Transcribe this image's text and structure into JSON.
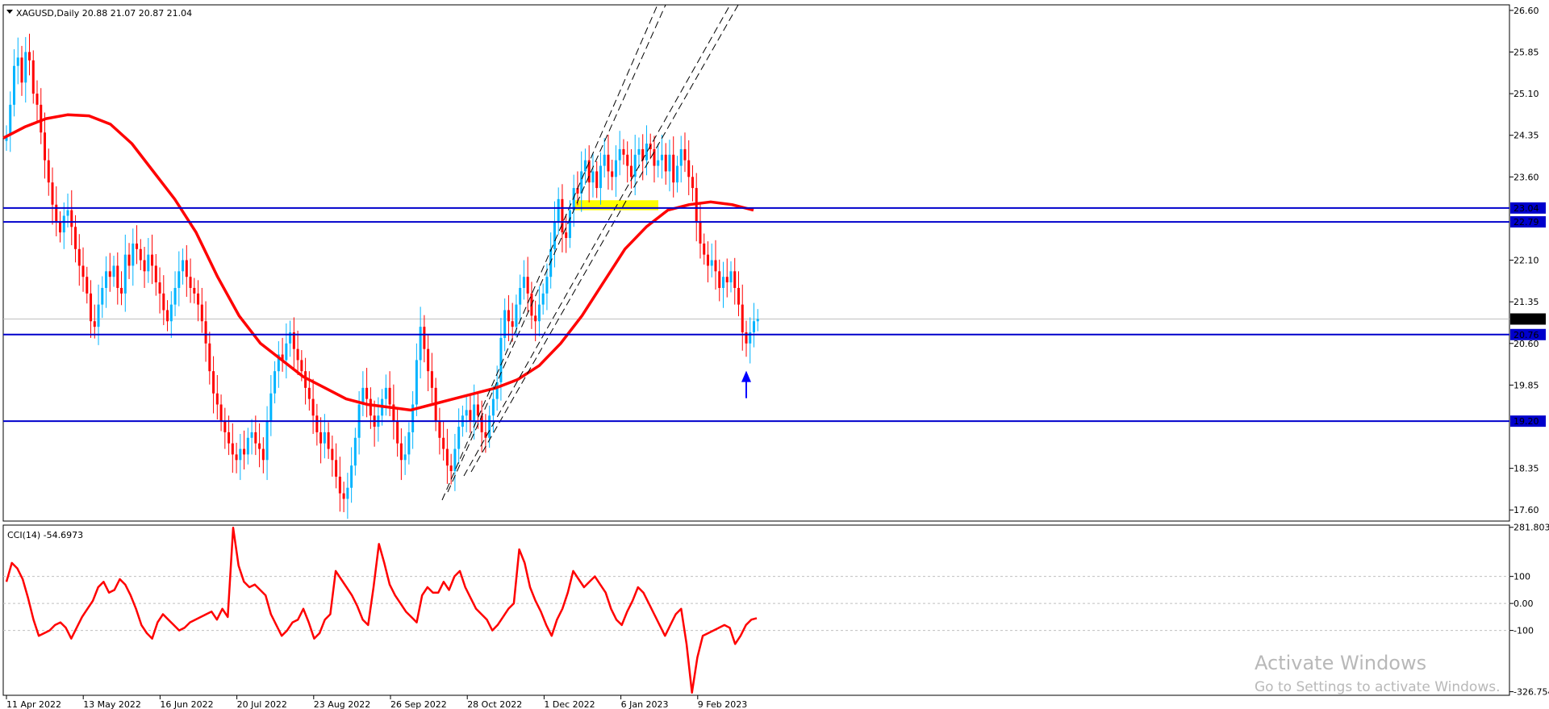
{
  "chart_data": [
    {
      "type": "candlestick",
      "symbol_header": "XAGUSD,Daily  20.88 21.07 20.87 21.04",
      "ohlc_last": {
        "open": 20.88,
        "high": 21.07,
        "low": 20.87,
        "close": 21.04
      },
      "ylim": [
        17.4,
        26.7
      ],
      "y_ticks": [
        "26.60",
        "25.85",
        "25.10",
        "24.35",
        "23.60",
        "22.10",
        "21.35",
        "20.60",
        "19.85",
        "18.35",
        "17.60"
      ],
      "x_ticks": [
        "11 Apr 2022",
        "13 May 2022",
        "16 Jun 2022",
        "20 Jul 2022",
        "23 Aug 2022",
        "26 Sep 2022",
        "28 Oct 2022",
        "1 Dec 2022",
        "6 Jan 2023",
        "9 Feb 2023"
      ],
      "current_price": {
        "value": 21.04,
        "label": "21.04"
      },
      "horizontal_levels": [
        {
          "value": 23.04,
          "label": "23.04"
        },
        {
          "value": 22.79,
          "label": "22.79"
        },
        {
          "value": 20.76,
          "label": "20.76"
        },
        {
          "value": 19.2,
          "label": "19.20"
        }
      ],
      "closes": [
        24.35,
        24.9,
        25.6,
        25.75,
        25.3,
        25.85,
        25.7,
        25.1,
        24.9,
        24.4,
        23.9,
        23.5,
        23.1,
        22.8,
        22.6,
        22.9,
        23.0,
        22.7,
        22.3,
        22.0,
        21.8,
        21.5,
        21.0,
        20.9,
        21.3,
        21.6,
        21.9,
        21.8,
        22.0,
        21.6,
        21.5,
        22.2,
        22.0,
        22.4,
        22.3,
        22.1,
        21.9,
        22.2,
        22.0,
        21.7,
        21.5,
        21.2,
        21.0,
        21.3,
        21.6,
        21.9,
        22.1,
        21.8,
        21.6,
        21.5,
        21.3,
        21.0,
        20.6,
        20.1,
        19.7,
        19.5,
        19.2,
        19.0,
        18.8,
        18.6,
        18.5,
        18.7,
        18.6,
        18.9,
        19.0,
        18.8,
        18.7,
        18.5,
        19.2,
        19.7,
        20.1,
        20.4,
        20.3,
        20.6,
        20.8,
        20.5,
        20.3,
        20.1,
        19.8,
        19.6,
        19.3,
        19.0,
        18.8,
        19.0,
        18.7,
        18.5,
        18.2,
        17.9,
        17.8,
        18.0,
        18.4,
        18.9,
        19.5,
        19.8,
        19.6,
        19.3,
        19.1,
        19.3,
        19.6,
        19.8,
        19.5,
        19.2,
        18.8,
        18.5,
        18.6,
        19.0,
        19.5,
        20.3,
        20.9,
        20.5,
        20.1,
        19.8,
        19.2,
        18.9,
        18.7,
        18.4,
        18.3,
        18.7,
        19.1,
        19.3,
        19.4,
        19.2,
        19.5,
        19.3,
        19.0,
        18.9,
        19.3,
        19.6,
        19.9,
        20.7,
        21.2,
        21.0,
        20.9,
        21.3,
        21.6,
        21.8,
        21.5,
        21.1,
        21.0,
        21.3,
        21.5,
        21.8,
        22.3,
        22.8,
        23.2,
        22.6,
        22.5,
        23.0,
        23.4,
        23.3,
        23.7,
        23.9,
        23.5,
        23.7,
        23.4,
        23.8,
        24.0,
        23.7,
        23.6,
        23.9,
        24.1,
        24.0,
        23.8,
        23.6,
        24.0,
        24.1,
        23.9,
        24.2,
        24.1,
        23.8,
        23.9,
        24.0,
        23.7,
        24.0,
        23.5,
        23.8,
        24.1,
        23.9,
        23.6,
        23.4,
        22.8,
        22.4,
        22.2,
        22.0,
        22.1,
        21.9,
        21.6,
        21.8,
        21.7,
        21.9,
        21.6,
        21.3,
        20.8,
        20.6,
        20.8,
        21.0,
        21.04
      ],
      "ma_line": [
        24.3,
        24.5,
        24.65,
        24.72,
        24.7,
        24.55,
        24.2,
        23.7,
        23.2,
        22.6,
        21.8,
        21.1,
        20.6,
        20.3,
        20.0,
        19.8,
        19.6,
        19.5,
        19.45,
        19.4,
        19.5,
        19.6,
        19.7,
        19.8,
        19.95,
        20.2,
        20.6,
        21.1,
        21.7,
        22.3,
        22.7,
        23.0,
        23.1,
        23.15,
        23.1,
        23.0
      ],
      "ema_channel": [
        {
          "from": [
            17.65,
            25.2
          ],
          "to": [
            26.6,
            2.2
          ]
        },
        {
          "from": [
            17.85,
            25.2
          ],
          "to": [
            26.6,
            2.6
          ]
        }
      ],
      "highlight_zone": {
        "y_low": 23.0,
        "y_high": 23.18
      },
      "annotation": "↑",
      "color_bull": "#00b4ff",
      "color_bear": "#ff0000",
      "color_ma": "#ff0000",
      "color_levels": "#0000cc",
      "color_zone": "#ffff00"
    },
    {
      "type": "line",
      "title": "CCI(14) -54.6973",
      "ylim": [
        -340,
        290
      ],
      "y_ticks": [
        "281.803",
        "100",
        "0.00",
        "-100",
        "-326.754"
      ],
      "ref_levels": [
        100,
        0,
        -100
      ],
      "values": [
        80,
        150,
        130,
        90,
        20,
        -60,
        -120,
        -110,
        -100,
        -80,
        -70,
        -90,
        -130,
        -90,
        -50,
        -20,
        10,
        60,
        80,
        40,
        50,
        90,
        70,
        30,
        -20,
        -80,
        -110,
        -130,
        -70,
        -40,
        -60,
        -80,
        -100,
        -90,
        -70,
        -60,
        -50,
        -40,
        -30,
        -60,
        -20,
        -50,
        280,
        140,
        80,
        60,
        70,
        50,
        30,
        -40,
        -80,
        -120,
        -100,
        -70,
        -60,
        -20,
        -70,
        -130,
        -110,
        -60,
        -40,
        120,
        90,
        60,
        30,
        -10,
        -60,
        -80,
        60,
        220,
        150,
        70,
        30,
        0,
        -30,
        -50,
        -70,
        30,
        60,
        40,
        40,
        80,
        50,
        100,
        120,
        60,
        20,
        -20,
        -40,
        -60,
        -100,
        -80,
        -50,
        -20,
        0,
        200,
        150,
        60,
        10,
        -30,
        -80,
        -120,
        -60,
        -20,
        40,
        120,
        90,
        60,
        80,
        100,
        70,
        40,
        -20,
        -60,
        -80,
        -30,
        10,
        60,
        40,
        0,
        -40,
        -80,
        -120,
        -80,
        -40,
        -20,
        -150,
        -330,
        -200,
        -120,
        -110,
        -100,
        -90,
        -80,
        -90,
        -150,
        -120,
        -80,
        -60,
        -54.7
      ],
      "color_line": "#ff0000"
    }
  ],
  "watermark": {
    "line1": "Activate Windows",
    "line2": "Go to Settings to activate Windows."
  }
}
